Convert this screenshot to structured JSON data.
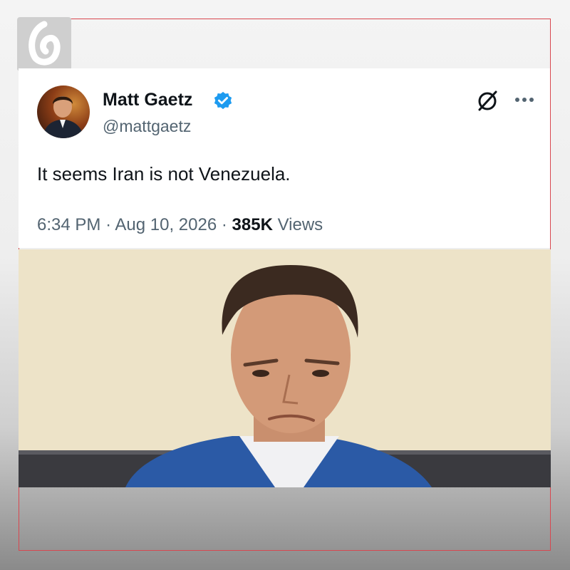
{
  "tweet": {
    "author_name": "Matt Gaetz",
    "handle": "@mattgaetz",
    "text": "It seems Iran is not Venezuela.",
    "time": "6:34 PM",
    "separator": "·",
    "date": "Aug 10, 2026",
    "views_count": "385K",
    "views_label": "Views",
    "verified": true
  },
  "icons": {
    "verified": "verified-badge-icon",
    "grok": "grok-icon",
    "more": "more-options-icon",
    "logo": "channel-logo-icon"
  },
  "colors": {
    "verified_blue": "#1d9bf0",
    "text": "#0f1419",
    "secondary_text": "#536471",
    "frame_border": "#d8474f"
  }
}
